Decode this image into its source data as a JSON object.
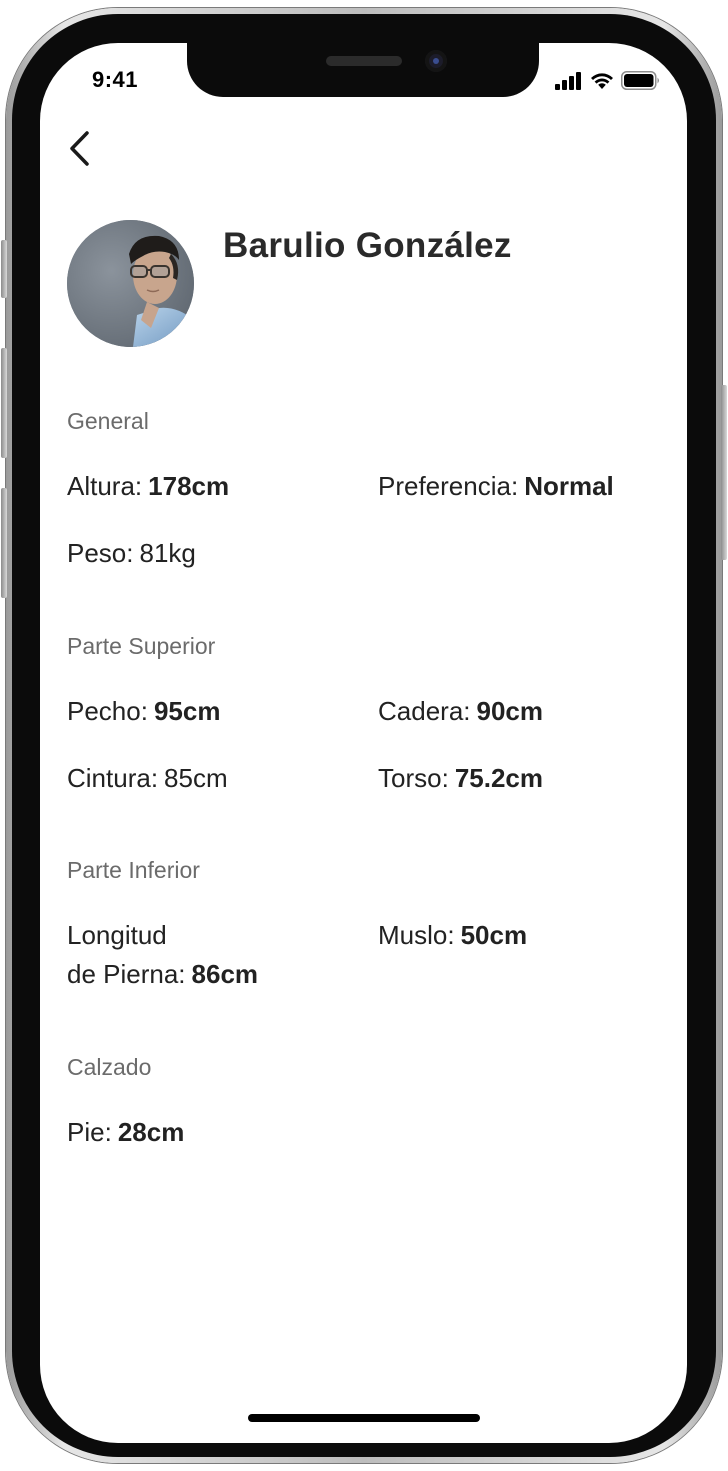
{
  "status_bar": {
    "time": "9:41",
    "icons": [
      "cellular-signal-icon",
      "wifi-icon",
      "battery-icon"
    ]
  },
  "header": {
    "back_icon": "chevron-left-icon"
  },
  "profile": {
    "name": "Barulio González",
    "avatar_icon": "user-photo-avatar"
  },
  "sections": {
    "general": {
      "title": "General",
      "altura_label": "Altura:",
      "altura_value": "178cm",
      "preferencia_label": "Preferencia:",
      "preferencia_value": "Normal",
      "peso_label": "Peso:",
      "peso_value": "81kg"
    },
    "superior": {
      "title": "Parte Superior",
      "pecho_label": "Pecho:",
      "pecho_value": "95cm",
      "cadera_label": "Cadera:",
      "cadera_value": "90cm",
      "cintura_label": "Cintura:",
      "cintura_value": "85cm",
      "torso_label": "Torso:",
      "torso_value": "75.2cm"
    },
    "inferior": {
      "title": "Parte Inferior",
      "longitud_label_line1": "Longitud",
      "longitud_label_line2": "de Pierna:",
      "longitud_value": "86cm",
      "muslo_label": "Muslo:",
      "muslo_value": "50cm"
    },
    "calzado": {
      "title": "Calzado",
      "pie_label": "Pie:",
      "pie_value": "28cm"
    }
  },
  "colors": {
    "text_primary": "#222222",
    "text_section": "#6b6b6b",
    "background": "#ffffff"
  }
}
